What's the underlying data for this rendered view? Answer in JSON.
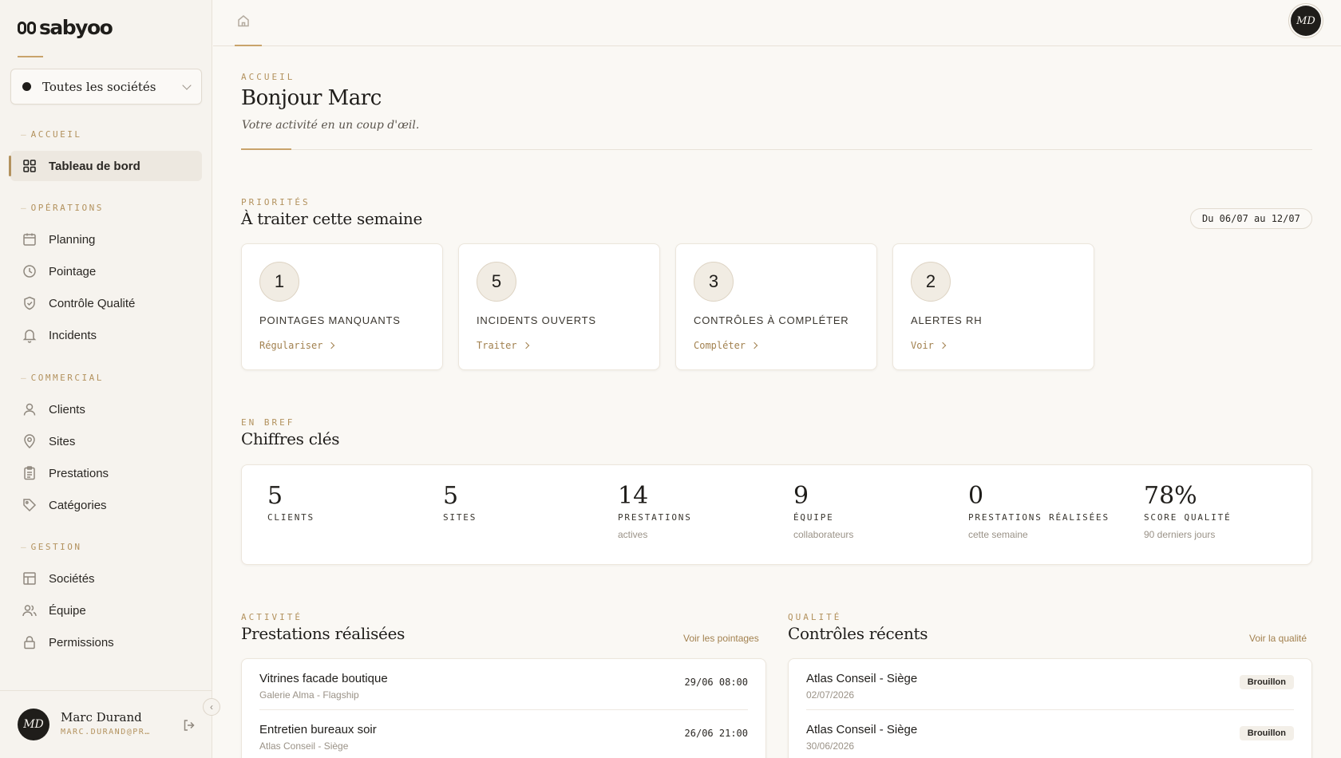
{
  "brand": {
    "name": "sabyoo"
  },
  "company_selector": {
    "label": "Toutes les sociétés"
  },
  "sidebar": {
    "sections": [
      {
        "label": "Accueil",
        "items": [
          {
            "label": "Tableau de bord",
            "icon": "grid-icon",
            "active": true
          }
        ]
      },
      {
        "label": "Opérations",
        "items": [
          {
            "label": "Planning",
            "icon": "calendar-icon"
          },
          {
            "label": "Pointage",
            "icon": "clock-icon"
          },
          {
            "label": "Contrôle Qualité",
            "icon": "shield-icon"
          },
          {
            "label": "Incidents",
            "icon": "bell-icon"
          }
        ]
      },
      {
        "label": "Commercial",
        "items": [
          {
            "label": "Clients",
            "icon": "user-icon"
          },
          {
            "label": "Sites",
            "icon": "map-pin-icon"
          },
          {
            "label": "Prestations",
            "icon": "clipboard-icon"
          },
          {
            "label": "Catégories",
            "icon": "tag-icon"
          }
        ]
      },
      {
        "label": "Gestion",
        "items": [
          {
            "label": "Sociétés",
            "icon": "building-icon"
          },
          {
            "label": "Équipe",
            "icon": "users-icon"
          },
          {
            "label": "Permissions",
            "icon": "lock-icon"
          }
        ]
      }
    ]
  },
  "user": {
    "initials": "MD",
    "name": "Marc Durand",
    "email": "MARC.DURAND@PR…"
  },
  "header": {
    "initials": "MD"
  },
  "welcome": {
    "kicker": "Accueil",
    "title": "Bonjour Marc",
    "subtitle": "Votre activité en un coup d'œil."
  },
  "priorities": {
    "kicker": "Priorités",
    "title": "À traiter cette semaine",
    "date_range": "Du 06/07 au 12/07",
    "cards": [
      {
        "count": "1",
        "label": "Pointages manquants",
        "action": "Régulariser"
      },
      {
        "count": "5",
        "label": "Incidents ouverts",
        "action": "Traiter"
      },
      {
        "count": "3",
        "label": "Contrôles à compléter",
        "action": "Compléter"
      },
      {
        "count": "2",
        "label": "Alertes RH",
        "action": "Voir"
      }
    ]
  },
  "key_figures": {
    "kicker": "En bref",
    "title": "Chiffres clés",
    "stats": [
      {
        "value": "5",
        "label": "Clients",
        "sub": ""
      },
      {
        "value": "5",
        "label": "Sites",
        "sub": ""
      },
      {
        "value": "14",
        "label": "Prestations",
        "sub": "actives"
      },
      {
        "value": "9",
        "label": "Équipe",
        "sub": "collaborateurs"
      },
      {
        "value": "0",
        "label": "Prestations réalisées",
        "sub": "cette semaine"
      },
      {
        "value": "78%",
        "label": "Score qualité",
        "sub": "90 derniers jours"
      }
    ]
  },
  "activity": {
    "kicker": "Activité",
    "title": "Prestations réalisées",
    "link": "Voir les pointages",
    "rows": [
      {
        "title": "Vitrines facade boutique",
        "sub": "Galerie Alma - Flagship",
        "time": "29/06 08:00"
      },
      {
        "title": "Entretien bureaux soir",
        "sub": "Atlas Conseil - Siège",
        "time": "26/06 21:00"
      }
    ]
  },
  "quality": {
    "kicker": "Qualité",
    "title": "Contrôles récents",
    "link": "Voir la qualité",
    "rows": [
      {
        "title": "Atlas Conseil - Siège",
        "sub": "02/07/2026",
        "badge": "Brouillon"
      },
      {
        "title": "Atlas Conseil - Siège",
        "sub": "30/06/2026",
        "badge": "Brouillon"
      }
    ]
  }
}
